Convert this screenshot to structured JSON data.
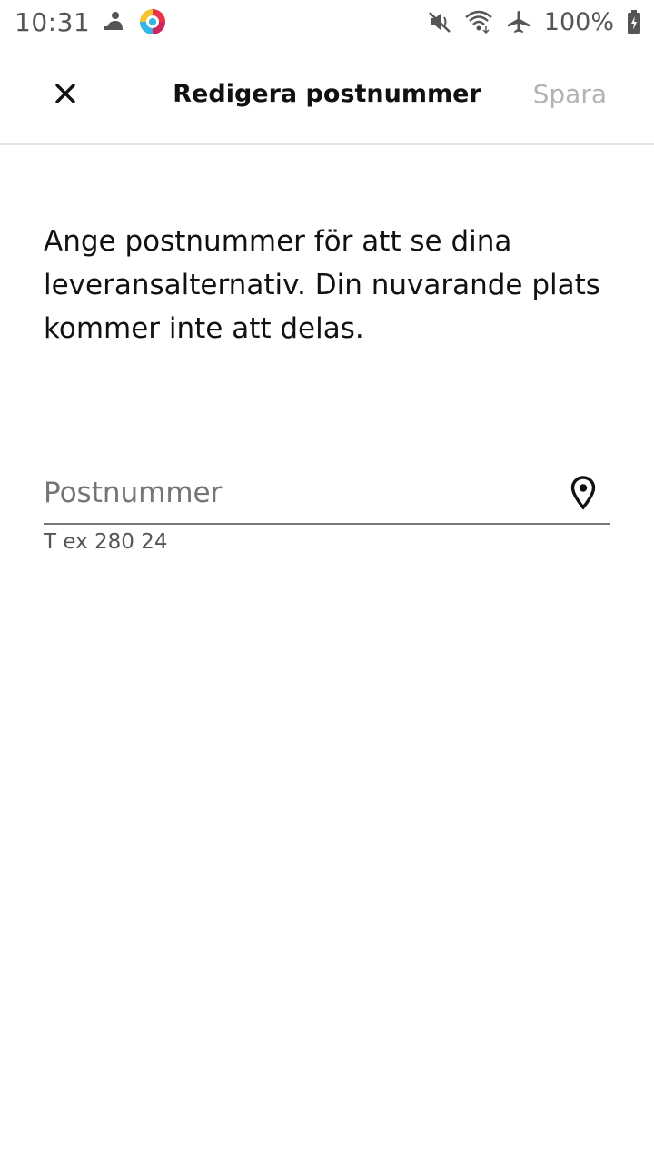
{
  "status_bar": {
    "time": "10:31",
    "battery": "100%",
    "icons_left": [
      "notification-app-icon",
      "colorful-app-icon"
    ],
    "icons_right": [
      "mute-icon",
      "wifi-icon",
      "airplane-icon",
      "battery-icon"
    ]
  },
  "app_bar": {
    "close_icon": "close-icon",
    "title": "Redigera postnummer",
    "save_label": "Spara",
    "save_color": "#b3b3b3"
  },
  "content": {
    "description": "Ange postnummer för att se dina leveransalternativ. Din nuvarande plats kommer inte att delas.",
    "postal_field": {
      "value": "",
      "placeholder": "Postnummer",
      "helper": "T ex 280 24",
      "trailing_icon": "location-pin-icon"
    }
  }
}
